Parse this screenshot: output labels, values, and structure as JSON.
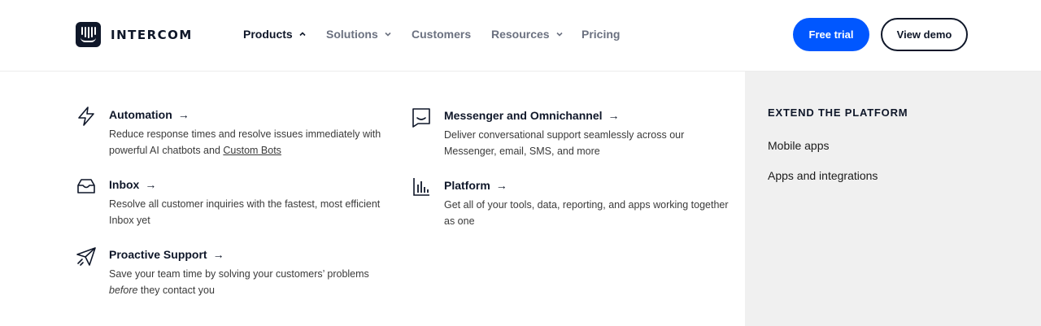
{
  "brand": {
    "name": "INTERCOM"
  },
  "nav": {
    "items": [
      {
        "label": "Products",
        "active": true,
        "has_dropdown": true,
        "chevron": "up"
      },
      {
        "label": "Solutions",
        "active": false,
        "has_dropdown": true,
        "chevron": "down"
      },
      {
        "label": "Customers",
        "active": false,
        "has_dropdown": false
      },
      {
        "label": "Resources",
        "active": false,
        "has_dropdown": true,
        "chevron": "down"
      },
      {
        "label": "Pricing",
        "active": false,
        "has_dropdown": false
      }
    ]
  },
  "cta": {
    "primary": "Free trial",
    "secondary": "View demo",
    "primary_color": "#0057ff"
  },
  "products": {
    "automation": {
      "title": "Automation",
      "desc_prefix": "Reduce response times and resolve issues immediately with powerful AI chatbots and ",
      "desc_link": "Custom Bots",
      "icon": "lightning-icon"
    },
    "inbox": {
      "title": "Inbox",
      "desc": "Resolve all customer inquiries with the fastest, most efficient Inbox yet",
      "icon": "inbox-tray-icon"
    },
    "proactive": {
      "title": "Proactive Support",
      "desc_prefix": "Save your team time by solving your customers’ problems ",
      "desc_em": "before",
      "desc_suffix": " they contact you",
      "icon": "paper-plane-icon"
    },
    "messenger": {
      "title": "Messenger and Omnichannel",
      "desc": "Deliver conversational support seamlessly across our Messenger, email, SMS, and more",
      "icon": "chat-bubble-icon"
    },
    "platform": {
      "title": "Platform",
      "desc": "Get all of your tools, data, reporting, and apps working together as one",
      "icon": "bar-chart-icon"
    }
  },
  "arrow": "→",
  "extend": {
    "heading": "EXTEND THE PLATFORM",
    "links": [
      "Mobile apps",
      "Apps and integrations"
    ]
  }
}
